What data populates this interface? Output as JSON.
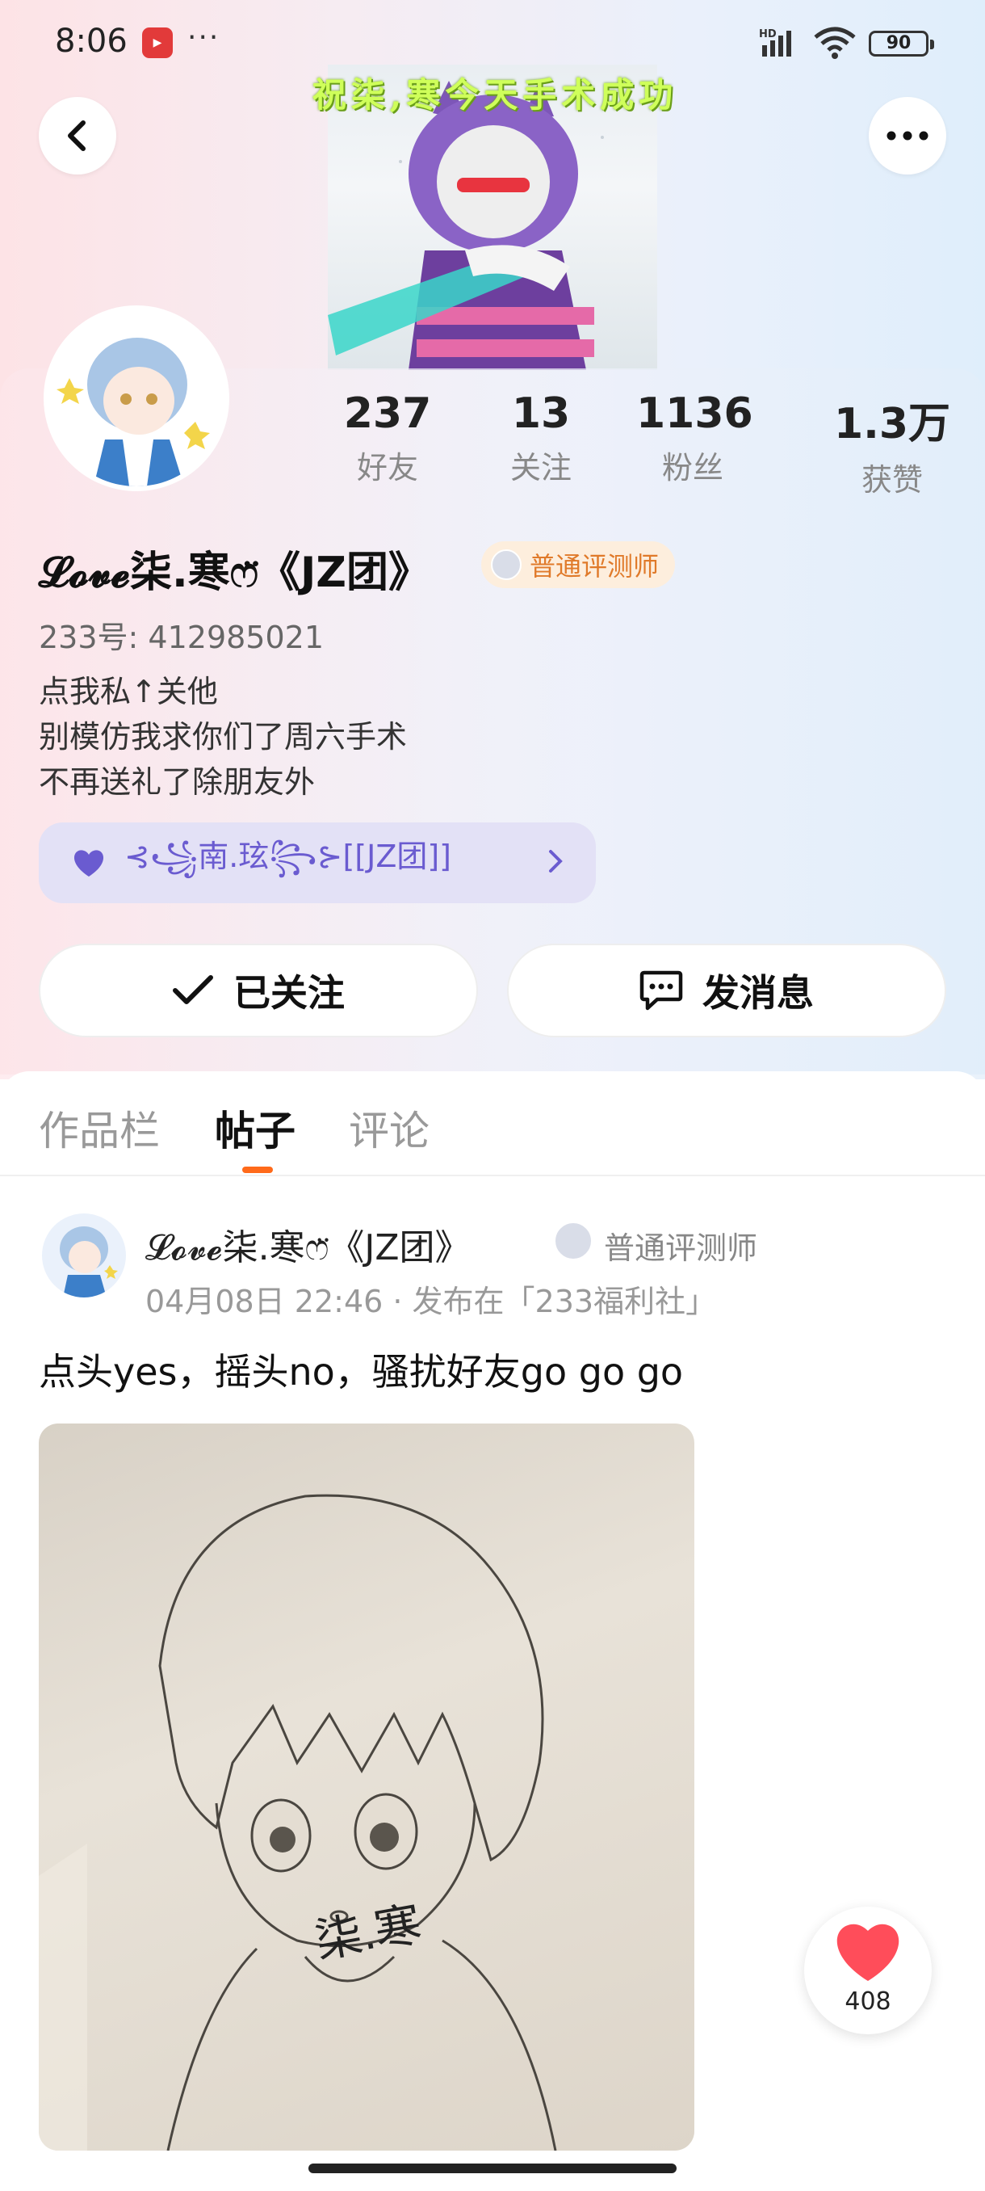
{
  "status_bar": {
    "time": "8:06",
    "dots": "···",
    "battery": "90",
    "net": "HD"
  },
  "header": {
    "banner_text": "祝柒,寒今天手术成功"
  },
  "profile": {
    "stats": [
      {
        "value": "237",
        "label": "好友"
      },
      {
        "value": "13",
        "label": "关注"
      },
      {
        "value": "1136",
        "label": "粉丝"
      },
      {
        "value": "1.3万",
        "label": "获赞"
      }
    ],
    "username": "𝓛𝓸𝓿𝓮柒.寒ෆ̈《JZ团》",
    "badge": "普通评测师",
    "uid": "233号: 412985021",
    "bio": [
      "点我私↑关他",
      "别模仿我求你们了周六手术",
      "不再送礼了除朋友外"
    ],
    "group": "⊰꧁南.玹꧂⊱[[JZ团]]"
  },
  "actions": {
    "follow_label": "已关注",
    "message_label": "发消息"
  },
  "tabs": [
    {
      "label": "作品栏",
      "active": false
    },
    {
      "label": "帖子",
      "active": true
    },
    {
      "label": "评论",
      "active": false
    }
  ],
  "post": {
    "username": "𝓛𝓸𝓿𝓮柒.寒ෆ̈《JZ团》",
    "badge": "普通评测师",
    "meta": "04月08日 22:46 · 发布在「233福利社」",
    "text": "点头yes，摇头no，骚扰好友go go go",
    "image_caption": "柒.寒",
    "likes": "408"
  },
  "colors": {
    "accent": "#ff6a1a",
    "badge_text": "#e07a2a",
    "group_text": "#6a5bd0",
    "heart": "#ff4d5a"
  }
}
